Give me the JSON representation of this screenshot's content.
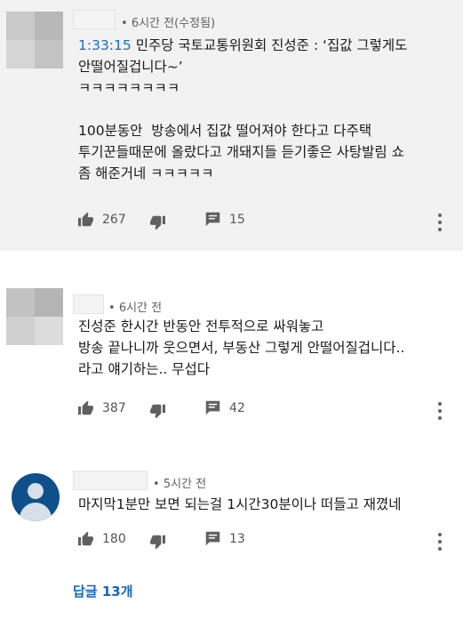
{
  "comments": [
    {
      "time": "6시간 전(수정됨)",
      "timestamp_link": "1:33:15",
      "lines": [
        "민주당 국토교통위원회 진성준 : ‘집값 그렇게도",
        "안떨어질겁니다~’",
        "ㅋㅋㅋㅋㅋㅋㅋㅋ",
        "",
        "100분동안  방송에서 집값 떨어져야 한다고 다주택",
        "투기꾼들때문에 올랐다고 개돼지들 듣기좋은 사탕발림 쇼",
        "좀 해준거네 ㅋㅋㅋㅋㅋ"
      ],
      "likes": "267",
      "replies": "15"
    },
    {
      "time": "6시간 전",
      "lines": [
        "진성준 한시간 반동안 전투적으로 싸워놓고",
        "방송 끝나니까 웃으면서, 부동산 그렇게 안떨어질겁니다..",
        "라고 얘기하는.. 무섭다"
      ],
      "likes": "387",
      "replies": "42"
    },
    {
      "time": "5시간 전",
      "lines": [
        "마지막1분만 보면 되는걸 1시간30분이나 떠들고 재꼈네"
      ],
      "likes": "180",
      "replies": "13"
    }
  ],
  "view_replies": "답글 13개",
  "icons": {
    "like": "thumbs-up-icon",
    "dislike": "thumbs-down-icon",
    "reply": "reply-comment-icon",
    "more": "more-vertical-icon",
    "avatar_default": "default-user-avatar-icon"
  },
  "colors": {
    "timestamp_link": "#1a6ccf",
    "view_replies": "#1565c0",
    "first_comment_bg": "#f2f2f2",
    "default_avatar_bg": "#0f4f8c"
  }
}
